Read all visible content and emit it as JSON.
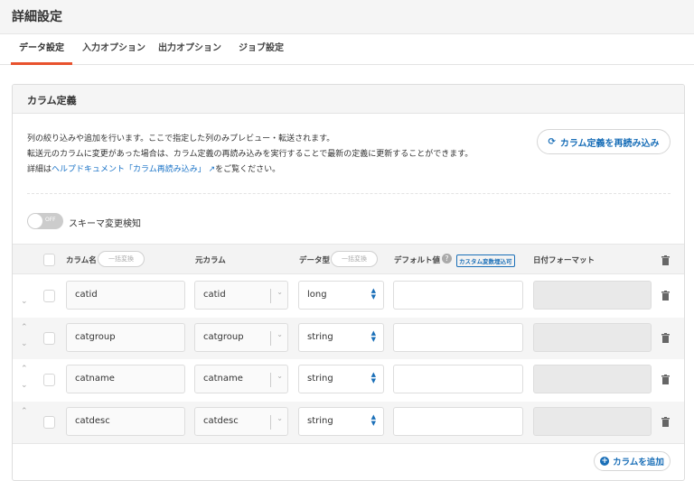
{
  "header": {
    "title": "詳細設定"
  },
  "tabs": [
    {
      "label": "データ設定",
      "active": true
    },
    {
      "label": "入力オプション"
    },
    {
      "label": "出力オプション"
    },
    {
      "label": "ジョブ設定"
    }
  ],
  "panel": {
    "title": "カラム定義",
    "desc1": "列の絞り込みや追加を行います。ここで指定した列のみプレビュー・転送されます。",
    "desc2": "転送元のカラムに変更があった場合は、カラム定義の再読み込みを実行することで最新の定義に更新することができます。",
    "desc3_prefix": "詳細は",
    "desc3_link": "ヘルプドキュメント「カラム再読み込み」",
    "desc3_suffix": "をご覧ください。",
    "reload_label": "カラム定義を再読み込み",
    "toggle_state": "OFF",
    "toggle_label": "スキーマ変更検知",
    "add_label": "カラムを追加"
  },
  "table": {
    "headers": {
      "name": "カラム名",
      "bulk": "一括変換",
      "source": "元カラム",
      "type": "データ型",
      "default": "デフォルト値",
      "custom_badge": "カスタム変数埋込可",
      "date_format": "日付フォーマット"
    },
    "rows": [
      {
        "name": "catid",
        "source": "catid",
        "type": "long",
        "default": "",
        "date_format": ""
      },
      {
        "name": "catgroup",
        "source": "catgroup",
        "type": "string",
        "default": "",
        "date_format": ""
      },
      {
        "name": "catname",
        "source": "catname",
        "type": "string",
        "default": "",
        "date_format": ""
      },
      {
        "name": "catdesc",
        "source": "catdesc",
        "type": "string",
        "default": "",
        "date_format": ""
      }
    ]
  }
}
